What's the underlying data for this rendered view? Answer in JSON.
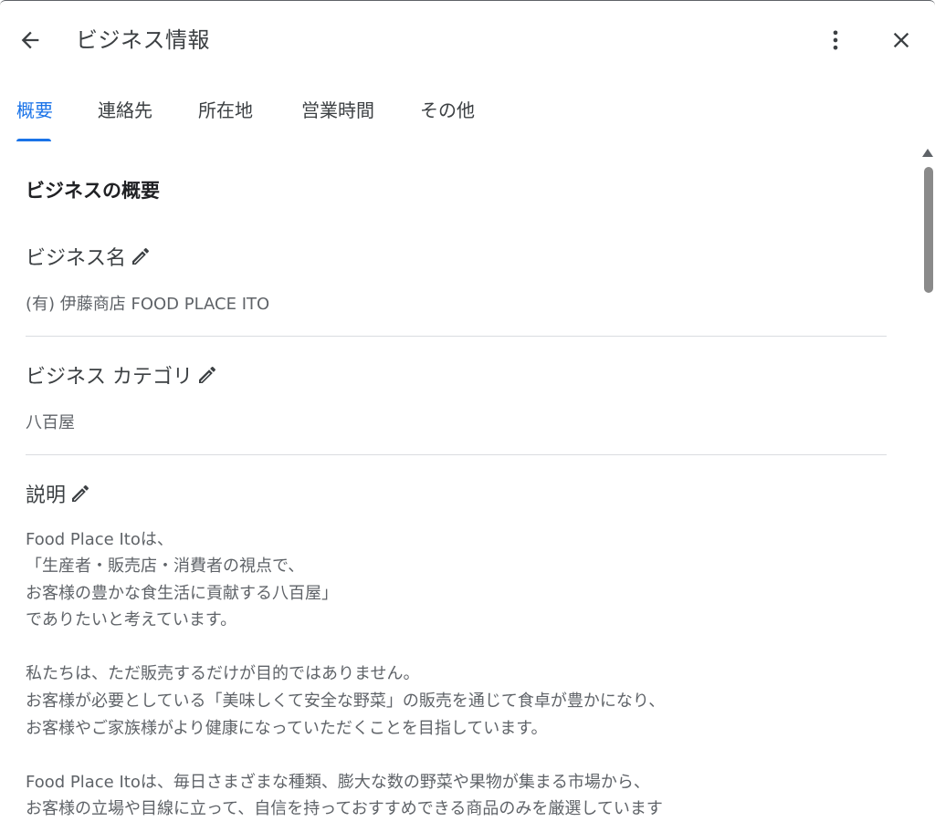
{
  "header": {
    "title": "ビジネス情報"
  },
  "tabs": [
    {
      "label": "概要",
      "active": true
    },
    {
      "label": "連絡先",
      "active": false
    },
    {
      "label": "所在地",
      "active": false
    },
    {
      "label": "営業時間",
      "active": false
    },
    {
      "label": "その他",
      "active": false
    }
  ],
  "overview": {
    "section_title": "ビジネスの概要",
    "business_name": {
      "label": "ビジネス名",
      "value": "(有) 伊藤商店 FOOD PLACE ITO"
    },
    "business_category": {
      "label": "ビジネス カテゴリ",
      "value": "八百屋"
    },
    "description": {
      "label": "説明",
      "lines": [
        "Food Place Itoは、",
        "「生産者・販売店・消費者の視点で、",
        "お客様の豊かな食生活に貢献する八百屋」",
        "でありたいと考えています。",
        "",
        "私たちは、ただ販売するだけが目的ではありません。",
        "お客様が必要としている「美味しくて安全な野菜」の販売を通じて食卓が豊かになり、",
        "お客様やご家族様がより健康になっていただくことを目指しています。",
        "",
        "Food Place Itoは、毎日さまざまな種類、膨大な数の野菜や果物が集まる市場から、",
        "お客様の立場や目線に立って、自信を持っておすすめできる商品のみを厳選しています"
      ]
    }
  },
  "colors": {
    "accent": "#1a73e8",
    "text": "#202124",
    "secondary_text": "#5f6368",
    "divider": "#dadce0"
  },
  "icons": {
    "back": "arrow-back-icon",
    "more": "more-vert-icon",
    "close": "close-icon",
    "edit": "pencil-icon"
  }
}
